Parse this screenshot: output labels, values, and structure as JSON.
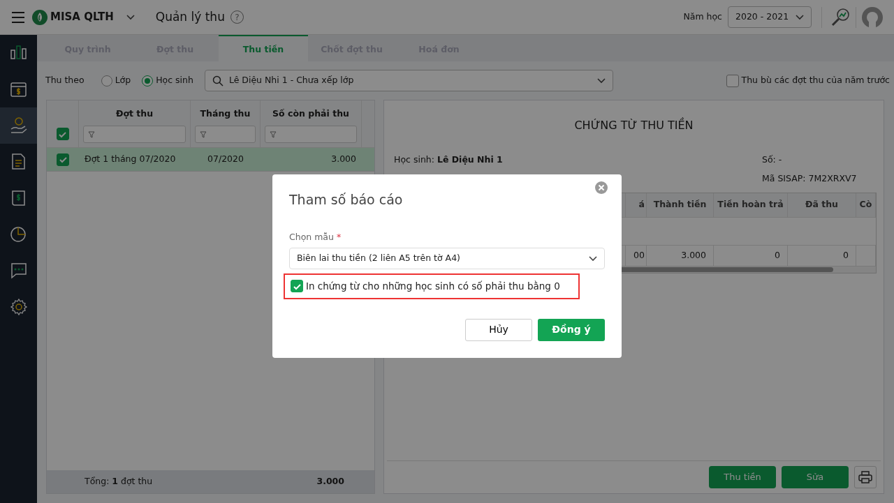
{
  "topbar": {
    "app_name": "MISA QLTH",
    "page_title": "Quản lý thu",
    "help": "?",
    "year_label": "Năm học",
    "year_value": "2020 - 2021"
  },
  "sidebar": {
    "items": [
      {
        "selected": false
      },
      {
        "selected": false
      },
      {
        "selected": true
      },
      {
        "selected": false
      },
      {
        "selected": false
      },
      {
        "selected": false
      },
      {
        "selected": false
      },
      {
        "selected": false
      }
    ]
  },
  "tabs": [
    {
      "label": "Quy trình",
      "selected": false
    },
    {
      "label": "Đợt thu",
      "selected": false
    },
    {
      "label": "Thu tiền",
      "selected": true
    },
    {
      "label": "Chốt đợt thu",
      "selected": false
    },
    {
      "label": "Hoá đơn",
      "selected": false
    }
  ],
  "filter": {
    "label": "Thu theo",
    "options": [
      {
        "label": "Lớp",
        "selected": false
      },
      {
        "label": "Học sinh",
        "selected": true
      }
    ],
    "student_value": "Lê Diệu Nhi 1 - Chưa xếp lớp",
    "carry_over": {
      "label": "Thu bù các đợt thu của năm trước",
      "checked": false
    }
  },
  "batch_grid": {
    "header_checked": true,
    "columns": [
      "Đợt thu",
      "Tháng thu",
      "Số còn phải thu"
    ],
    "rows": [
      {
        "checked": true,
        "selected": true,
        "cells": [
          "Đợt 1 tháng 07/2020",
          "07/2020",
          "3.000"
        ]
      }
    ],
    "footer": {
      "total": "Tổng: **1** đợt thu",
      "amount": "3.000"
    }
  },
  "receipt": {
    "title": "CHỨNG TỪ THU TIỀN",
    "student": "Học sinh: **Lê Diệu Nhi 1**",
    "number": "Số: -",
    "sisap": "Mã SISAP: 7M2XRXV7",
    "columns": [
      "á",
      "Thành tiền",
      "Tiền hoàn trả",
      "Đã thu",
      "Cò"
    ],
    "rows": [
      {
        "cells": [
          "00",
          "3.000",
          "0",
          "0"
        ]
      }
    ]
  },
  "buttons": [
    "Thu tiền",
    "Sửa"
  ],
  "dialog": {
    "title": "Tham số báo cáo",
    "template_label": "Chọn mẫu",
    "required_mark": "*",
    "template_value": "Biên lai thu tiền (2 liên A5 trên tờ A4)",
    "zero_option": {
      "label": "In chứng từ cho những học sinh có số phải thu bằng 0",
      "checked": true,
      "highlighted": true
    },
    "cancel": "Hủy",
    "ok": "Đồng ý"
  }
}
